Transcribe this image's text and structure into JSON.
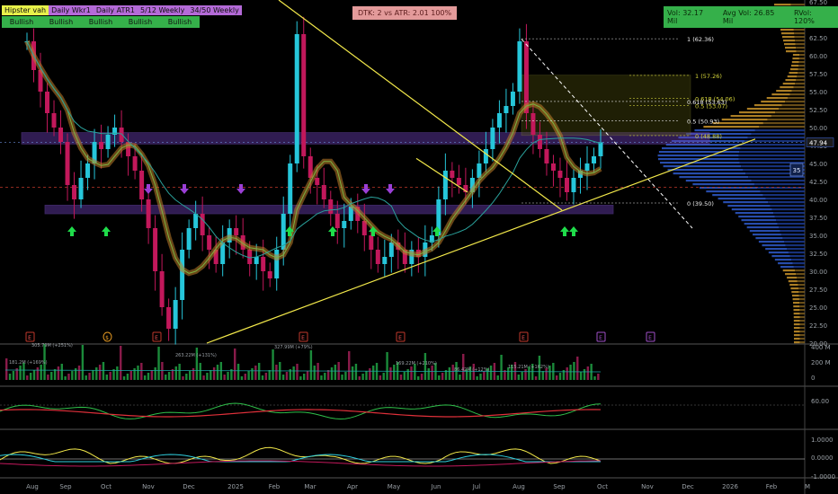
{
  "chart_data": {
    "type": "candlestick",
    "legend": {
      "labels": [
        "Hipster vah",
        "Daily Wkr1",
        "Daily ATR1",
        "5/12 Weekly",
        "34/50 Weekly"
      ],
      "states": [
        "Bullish",
        "Bullish",
        "Bullish",
        "Bullish",
        "Bullish"
      ]
    },
    "info_box": "DTK: 2 vs ATR: 2.01 100%",
    "volume_box": {
      "vol": "Vol: 32.17 Mil",
      "avg": "Avg Vol: 26.85 Mil",
      "rvol": "RVol: 120%"
    },
    "last_price": "47.94",
    "badge": "35",
    "price_axis": {
      "ticks": [
        "67.50",
        "65.00",
        "62.50",
        "60.00",
        "57.50",
        "55.00",
        "52.50",
        "50.00",
        "47.50",
        "45.00",
        "42.50",
        "40.00",
        "37.50",
        "35.00",
        "32.50",
        "30.00",
        "27.50",
        "25.00",
        "22.50",
        "20.00"
      ]
    },
    "fib_labels": [
      "1 (62.36)",
      "1 (57.26)",
      "0.618 (54.06)",
      "0.618 (53.63)",
      "0.5 (53.07)",
      "0.5 (50.93)",
      "0 (48.88)",
      "0 (39.50)"
    ],
    "volume_axis": [
      "400 M",
      "200 M",
      "0"
    ],
    "volume_annotations": [
      "181.2M (+169%)",
      "263.22M (+131%)",
      "327.99M (+79%)",
      "169.22M (+210%)",
      "86.42M (+12%)",
      "115.21M (+162%)",
      "305.79M (+251%)"
    ],
    "rsi_axis": [
      "60.00"
    ],
    "osc_axis": [
      "1.0000",
      "0.0000",
      "-1.0000"
    ],
    "x_axis": [
      "Aug",
      "Sep",
      "Oct",
      "Nov",
      "Dec",
      "2025",
      "Feb",
      "Mar",
      "Apr",
      "May",
      "Jun",
      "Jul",
      "Aug",
      "Sep",
      "Oct",
      "Nov",
      "Dec",
      "2026",
      "Feb",
      "M"
    ],
    "event_markers": [
      "E",
      "$",
      "E",
      "E",
      "E",
      "E",
      "E",
      "E"
    ],
    "closes": [
      62,
      58,
      55,
      52,
      50,
      48,
      42,
      40,
      43,
      45,
      48,
      47,
      49,
      50,
      48,
      46,
      44,
      40,
      36,
      30,
      25,
      22,
      26,
      33,
      36,
      38,
      35,
      33,
      31,
      34,
      36,
      35,
      33,
      31,
      32,
      30,
      29,
      33,
      38,
      45,
      63,
      46,
      43,
      42,
      40,
      38,
      36,
      37,
      39,
      37,
      35,
      33,
      31,
      32,
      34,
      33,
      31,
      33,
      32,
      34,
      35,
      40,
      44,
      43,
      42,
      41,
      43,
      45,
      47,
      50,
      52,
      53,
      55,
      62,
      52,
      49,
      47,
      45,
      44,
      43,
      41,
      43,
      44,
      45,
      46,
      47.94
    ]
  }
}
